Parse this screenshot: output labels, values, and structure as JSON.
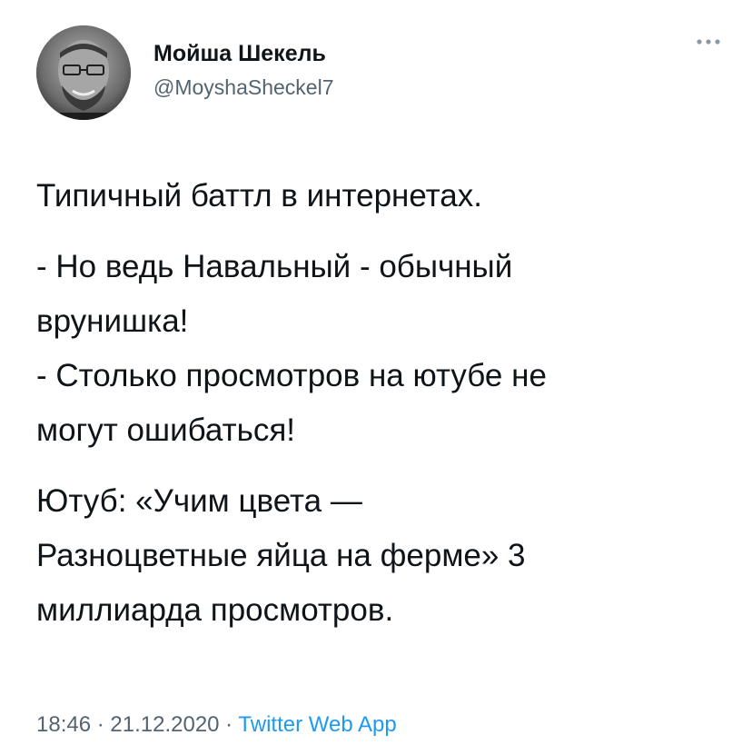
{
  "tweet": {
    "author": {
      "display_name": "Мойша Шекель",
      "handle": "@MoyshaSheckel7"
    },
    "more_icon": "more-horizontal-icon",
    "body": {
      "line_1": "Типичный баттл в интернетах.",
      "line_2": "- Но ведь Навальный - обычный",
      "line_3": "врунишка!",
      "line_4": "- Столько просмотров на ютубе не",
      "line_5": "могут ошибаться!",
      "line_6": "Ютуб: «Учим цвета —",
      "line_7": "Разноцветные яйца на ферме» 3",
      "line_8": "миллиарда просмотров."
    },
    "meta": {
      "time": "18:46",
      "separator": " · ",
      "date": "21.12.2020",
      "source": "Twitter Web App"
    },
    "colors": {
      "text": "#0f1419",
      "secondary": "#536471",
      "link": "#1d9bf0"
    }
  }
}
